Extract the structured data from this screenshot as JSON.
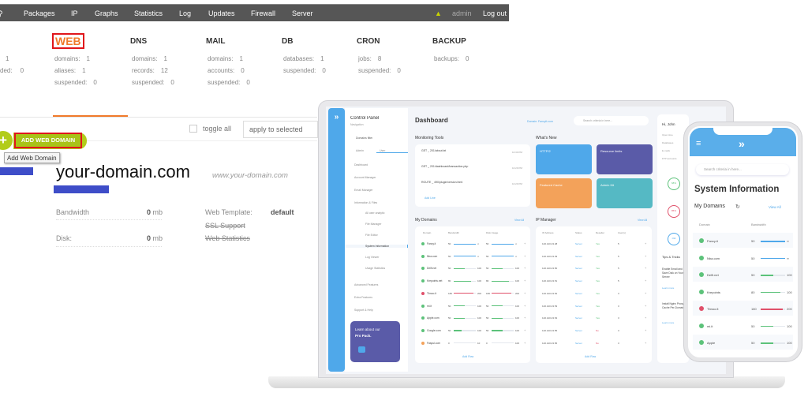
{
  "topbar": {
    "items": [
      "Packages",
      "IP",
      "Graphs",
      "Statistics",
      "Log",
      "Updates",
      "Firewall",
      "Server"
    ],
    "user": "admin",
    "logout": "Log out"
  },
  "stats": {
    "partial": {
      "rows": [
        [
          "",
          "1"
        ],
        [
          "ded:",
          "0"
        ]
      ]
    },
    "groups": [
      {
        "title": "WEB",
        "rows": [
          [
            "domains:",
            "1"
          ],
          [
            "aliases:",
            "1"
          ],
          [
            "suspended:",
            "0"
          ]
        ]
      },
      {
        "title": "DNS",
        "rows": [
          [
            "domains:",
            "1"
          ],
          [
            "records:",
            "12"
          ],
          [
            "suspended:",
            "0"
          ]
        ]
      },
      {
        "title": "MAIL",
        "rows": [
          [
            "domains:",
            "1"
          ],
          [
            "accounts:",
            "0"
          ],
          [
            "suspended:",
            "0"
          ]
        ]
      },
      {
        "title": "DB",
        "rows": [
          [
            "databases:",
            "1"
          ],
          [
            "suspended:",
            "0"
          ]
        ]
      },
      {
        "title": "CRON",
        "rows": [
          [
            "jobs:",
            "8"
          ],
          [
            "suspended:",
            "0"
          ]
        ]
      },
      {
        "title": "BACKUP",
        "rows": [
          [
            "backups:",
            "0"
          ]
        ]
      }
    ]
  },
  "toolbar": {
    "toggle_all": "toggle all",
    "apply_select": "apply to selected",
    "add_button": "ADD WEB DOMAIN",
    "add_tooltip": "Add Web Domain"
  },
  "domain": {
    "name": "your-domain.com",
    "alias": "www.your-domain.com",
    "bandwidth_label": "Bandwidth",
    "bandwidth_value": "0",
    "bandwidth_unit": "mb",
    "disk_label": "Disk:",
    "disk_value": "0",
    "disk_unit": "mb",
    "template_label": "Web Template:",
    "template_value": "default",
    "ssl": "SSL Support",
    "stats": "Web Statistics"
  },
  "colors": {
    "accent_orange": "#f07a2a",
    "add_green": "#b2cc1a",
    "highlight_red": "#e0161b",
    "laptop_blue": "#4fa8ea",
    "placeholder_blue": "#3e4dc8"
  },
  "laptop": {
    "brand": "Control Panel",
    "nav_sub": "Navigation",
    "filter": "Domains filter",
    "tabs": [
      "Admin",
      "User"
    ],
    "menu": [
      "Dashboard",
      "Account Manager",
      "Email Manager",
      "Information & Files",
      "All user analytic",
      "File Manager",
      "File Editor",
      "System Information",
      "Log Viewer",
      "Usage Statistics",
      "Advanced Features",
      "Extra Features",
      "Support & Help"
    ],
    "promo": {
      "line1": "Learn about our",
      "line2": "Pro Pack."
    },
    "title": "Dashboard",
    "domain_select": "Domain: Fancyit.com",
    "search": "Search criteria in here...",
    "monitoring": {
      "title": "Monitoring Tools",
      "items": [
        [
          "GET _ 201/about.txt",
          "10:30 PM"
        ],
        [
          "GET _ 201/dashboard/transaction.php",
          "10:29 PM"
        ],
        [
          "ROUTE _ 490/plugin/version.html",
          "10:29 PM"
        ]
      ],
      "add": "Add Line"
    },
    "whats_new": {
      "title": "What's New",
      "cards": [
        {
          "title": "HTTP/2",
          "color": "#4fa8ea"
        },
        {
          "title": "Resource limits",
          "color": "#5a5ba8"
        },
        {
          "title": "Featured Cache",
          "color": "#f3a25a"
        },
        {
          "title": "Admin Kit",
          "color": "#55b9c4"
        }
      ]
    },
    "my_domains": {
      "title": "My Domains",
      "view_all": "View All",
      "headers": [
        "Domain",
        "Bandwidth",
        "Disk Usage"
      ],
      "rows": [
        {
          "name": "Fancy.it",
          "status": "ok",
          "bw": [
            "50",
            "∞"
          ],
          "bw_fill": 1,
          "disk": [
            "50",
            "∞"
          ],
          "disk_fill": 1
        },
        {
          "name": "Nba.com",
          "status": "ok",
          "bw": [
            "50",
            "∞"
          ],
          "bw_fill": 1,
          "disk": [
            "50",
            "∞"
          ],
          "disk_fill": 1
        },
        {
          "name": "Delfi.net",
          "status": "ok",
          "bw": [
            "50",
            "100"
          ],
          "bw_fill": 0.5,
          "disk": [
            "50",
            "100"
          ],
          "disk_fill": 0.5
        },
        {
          "name": "Krepoints.net",
          "status": "ok",
          "bw": [
            "80",
            "100"
          ],
          "bw_fill": 0.8,
          "disk": [
            "80",
            "100"
          ],
          "disk_fill": 0.8
        },
        {
          "name": "Tbnoo.it",
          "status": "error",
          "bw": [
            "180",
            "200"
          ],
          "bw_fill": 0.9,
          "disk": [
            "180",
            "200"
          ],
          "disk_fill": 0.9
        },
        {
          "name": "mi.it",
          "status": "ok",
          "bw": [
            "50",
            "100"
          ],
          "bw_fill": 0.5,
          "disk": [
            "50",
            "100"
          ],
          "disk_fill": 0.5
        },
        {
          "name": "Apple.com",
          "status": "ok",
          "bw": [
            "50",
            "100"
          ],
          "bw_fill": 0.5,
          "disk": [
            "50",
            "100"
          ],
          "disk_fill": 0.5
        },
        {
          "name": "Google.com",
          "status": "ok",
          "bw": [
            "50",
            "100"
          ],
          "bw_fill": 0.35,
          "disk": [
            "50",
            "100"
          ],
          "disk_fill": 0.5
        },
        {
          "name": "Faspul.com",
          "status": "warn",
          "bw": [
            "0",
            "10"
          ],
          "bw_fill": 0,
          "disk": [
            "0",
            "100"
          ],
          "disk_fill": 0
        }
      ],
      "add": "Add Row"
    },
    "ip_manager": {
      "title": "IP Manager",
      "view_all": "View All",
      "headers": [
        "IP Address",
        "Status",
        "Reseller",
        "User(s)"
      ],
      "rows": [
        [
          "120.120.23.48",
          "Server",
          "Yes",
          "5"
        ],
        [
          "120.120.23.49",
          "Server",
          "Yes",
          "5"
        ],
        [
          "120.120.23.50",
          "Server",
          "Yes",
          "5"
        ],
        [
          "120.120.23.51",
          "Server",
          "Yes",
          "5"
        ],
        [
          "120.120.23.52",
          "Server",
          "Yes",
          "3"
        ],
        [
          "120.120.23.53",
          "Server",
          "Yes",
          "3"
        ],
        [
          "120.120.23.54",
          "Server",
          "Yes",
          "3"
        ],
        [
          "120.120.23.55",
          "Server",
          "No",
          "3"
        ],
        [
          "120.120.23.56",
          "Server",
          "No",
          "3"
        ]
      ],
      "add": "Add Row"
    },
    "right": {
      "greeting": "Hi, John",
      "rows": [
        "Open time",
        "Databases",
        "E-mails",
        "FTP accounts"
      ],
      "gauges": [
        {
          "label": "68%",
          "color": "#5cc27a"
        },
        {
          "label": "85%",
          "color": "#e0506a"
        },
        {
          "label": "Old",
          "color": "#4fa8ea"
        }
      ],
      "tips_title": "Tips & Tricks",
      "tips": [
        "Enable Email and Save Disk on Your Server",
        "Install Nginx Proxy and Cache Per-Domain"
      ],
      "learn": "Learn more"
    }
  },
  "phone": {
    "search": "Search criteria in here...",
    "title": "System Information",
    "section": "My Domains",
    "view_all": "View All",
    "headers": [
      "Domain",
      "Bandwidth"
    ],
    "rows": [
      {
        "name": "Fancy.it",
        "status": "ok",
        "bw": [
          "50",
          "∞"
        ],
        "fill": 1,
        "color": "#4fa8ea"
      },
      {
        "name": "Nba.com",
        "status": "ok",
        "bw": [
          "50",
          "∞"
        ],
        "fill": 1,
        "color": "#4fa8ea"
      },
      {
        "name": "Delfi.net",
        "status": "ok",
        "bw": [
          "50",
          "100"
        ],
        "fill": 0.5,
        "color": "#5cc27a"
      },
      {
        "name": "Krepoints",
        "status": "ok",
        "bw": [
          "80",
          "100"
        ],
        "fill": 0.8,
        "color": "#5cc27a"
      },
      {
        "name": "Tbnoo.it",
        "status": "error",
        "bw": [
          "180",
          "200"
        ],
        "fill": 0.9,
        "color": "#e0506a"
      },
      {
        "name": "mi.it",
        "status": "ok",
        "bw": [
          "50",
          "100"
        ],
        "fill": 0.5,
        "color": "#5cc27a"
      },
      {
        "name": "Apple",
        "status": "ok",
        "bw": [
          "50",
          "100"
        ],
        "fill": 0.5,
        "color": "#5cc27a"
      }
    ]
  }
}
